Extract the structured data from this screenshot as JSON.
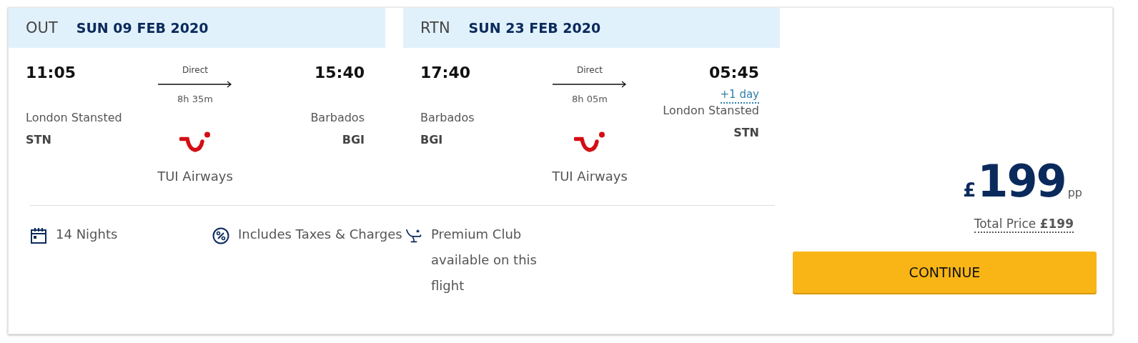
{
  "legs": [
    {
      "direction": "OUT",
      "date": "SUN 09 FEB 2020",
      "depart": {
        "time": "11:05",
        "city": "London Stansted",
        "code": "STN"
      },
      "stops": "Direct",
      "duration": "8h 35m",
      "arrive": {
        "time": "15:40",
        "city": "Barbados",
        "code": "BGI"
      },
      "airline": "TUI Airways"
    },
    {
      "direction": "RTN",
      "date": "SUN 23 FEB 2020",
      "depart": {
        "time": "17:40",
        "city": "Barbados",
        "code": "BGI"
      },
      "stops": "Direct",
      "duration": "8h 05m",
      "arrive": {
        "time": "05:45",
        "day_offset": "+1 day",
        "city": "London Stansted",
        "code": "STN"
      },
      "airline": "TUI Airways"
    }
  ],
  "features": [
    {
      "kind": "calendar",
      "text": "14 Nights"
    },
    {
      "kind": "percent",
      "text": "Includes Taxes & Charges"
    },
    {
      "kind": "seat",
      "text": "Premium Club available on this flight"
    }
  ],
  "price": {
    "currency": "£",
    "amount": "199",
    "unit": "pp",
    "total": "Total Price **£199**"
  },
  "button": "CONTINUE"
}
